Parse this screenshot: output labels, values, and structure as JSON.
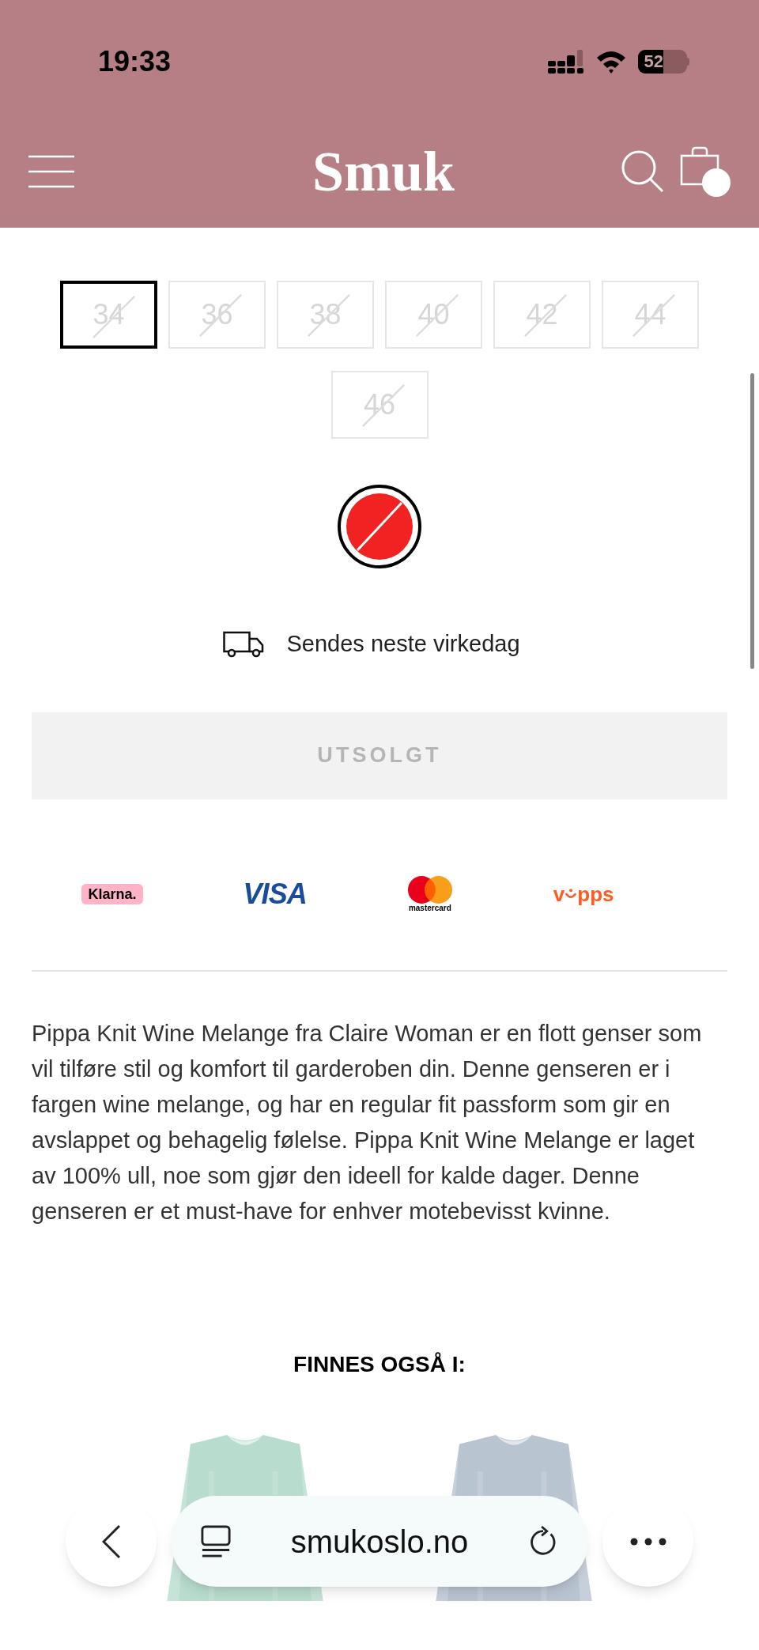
{
  "status_bar": {
    "time": "19:33",
    "battery": "52"
  },
  "header": {
    "logo": "Smuk",
    "cart_badge": true
  },
  "sizes": [
    {
      "label": "34",
      "selected": true,
      "available": false
    },
    {
      "label": "36",
      "selected": false,
      "available": false
    },
    {
      "label": "38",
      "selected": false,
      "available": false
    },
    {
      "label": "40",
      "selected": false,
      "available": false
    },
    {
      "label": "42",
      "selected": false,
      "available": false
    },
    {
      "label": "44",
      "selected": false,
      "available": false
    },
    {
      "label": "46",
      "selected": false,
      "available": false
    }
  ],
  "colors": [
    {
      "color": "#f02222",
      "selected": true,
      "available": false
    }
  ],
  "shipping": "Sendes neste virkedag",
  "buy_button": {
    "label": "UTSOLGT",
    "disabled": true
  },
  "payments": [
    {
      "kind": "klarna",
      "label": "Klarna."
    },
    {
      "kind": "visa",
      "label": "VISA"
    },
    {
      "kind": "mastercard",
      "label": "mastercard"
    },
    {
      "kind": "vipps",
      "label_start": "v",
      "label_end": "pps"
    }
  ],
  "description": "Pippa Knit Wine Melange fra Claire Woman er en flott genser som vil tilføre stil og komfort til garderoben din. Denne genseren er i fargen wine melange, og har en regular fit passform som gir en avslappet og behagelig følelse. Pippa Knit Wine Melange er laget av 100% ull, noe som gjør den ideell for kalde dager. Denne genseren er et must-have for enhver motebevisst kvinne.",
  "also_available": {
    "title": "FINNES OGSÅ I:"
  },
  "browser_bar": {
    "url": "smukoslo.no"
  }
}
